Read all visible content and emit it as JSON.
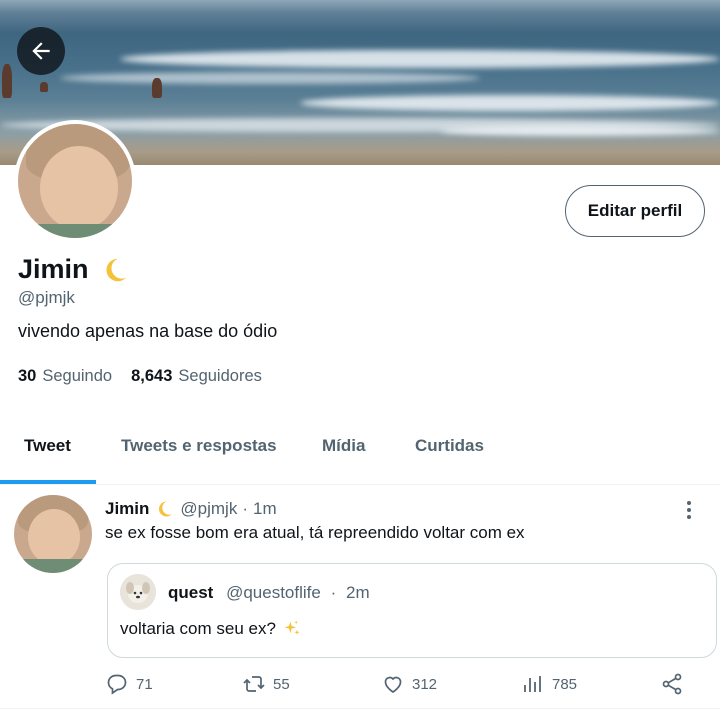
{
  "profile": {
    "name": "Jimin",
    "name_emoji": "crescent-moon-icon",
    "handle": "@pjmjk",
    "bio": "vivendo apenas na base do ódio",
    "edit_button": "Editar perfil",
    "following_count": "30",
    "following_label": "Seguindo",
    "followers_count": "8,643",
    "followers_label": "Seguidores"
  },
  "tabs": [
    {
      "label": "Tweet",
      "active": true
    },
    {
      "label": "Tweets e respostas",
      "active": false
    },
    {
      "label": "Mídia",
      "active": false
    },
    {
      "label": "Curtidas",
      "active": false
    }
  ],
  "tweet": {
    "author_name": "Jimin",
    "author_handle": "@pjmjk",
    "time_sep": "·",
    "time": "1m",
    "text": "se ex fosse bom era atual, tá repreendido voltar com ex",
    "quote": {
      "author_name": "quest",
      "author_handle": "@questoflife",
      "time_sep": "·",
      "time": "2m",
      "text": "voltaria com seu ex?"
    },
    "actions": {
      "replies": "71",
      "retweets": "55",
      "likes": "312",
      "views": "785"
    }
  },
  "colors": {
    "accent": "#1d9bf0",
    "text": "#0f1419",
    "muted": "#536471",
    "border": "#cfd9de"
  }
}
